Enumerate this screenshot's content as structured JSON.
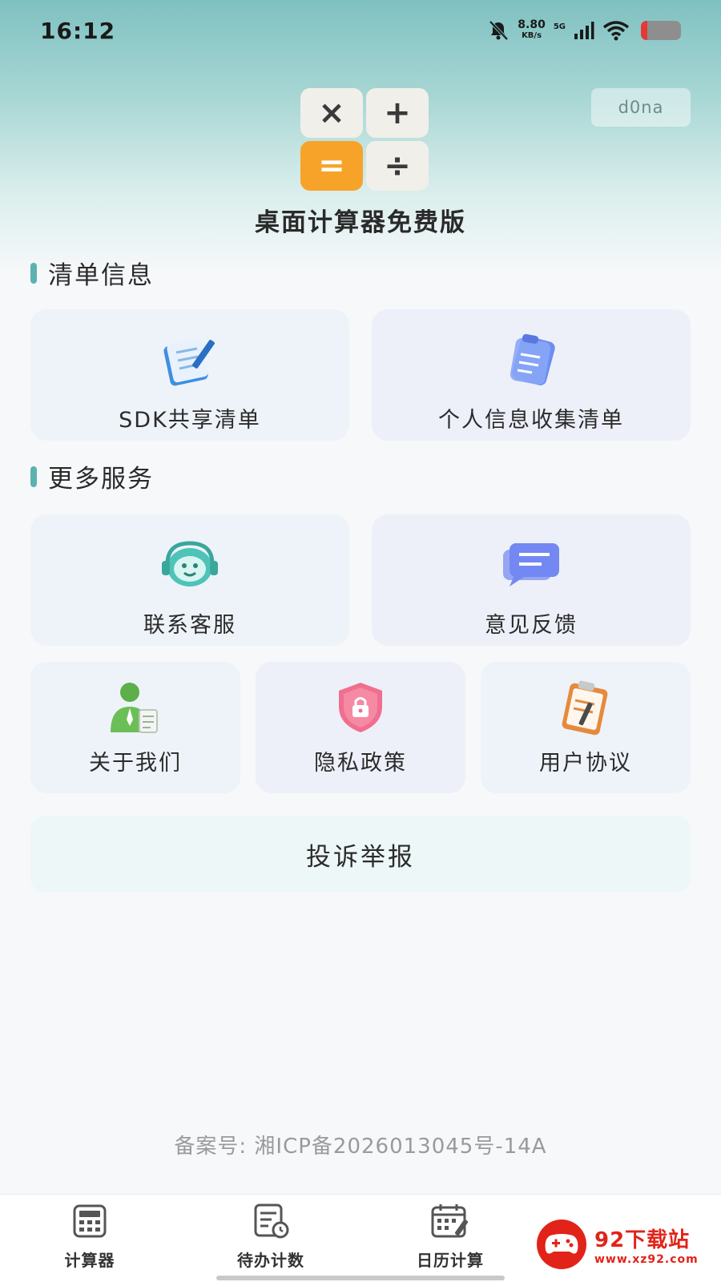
{
  "status_bar": {
    "time": "16:12",
    "net_speed": "8.80",
    "net_unit": "KB/s",
    "network": "5G",
    "battery_level": 0.15
  },
  "header": {
    "app_title": "桌面计算器免费版",
    "user_chip": "d0na",
    "logo_keys": [
      "×",
      "+",
      "=",
      "÷"
    ]
  },
  "sections": {
    "list_info": {
      "title": "清单信息",
      "items": [
        {
          "label": "SDK共享清单",
          "icon": "notepad-pen-icon"
        },
        {
          "label": "个人信息收集清单",
          "icon": "clipboard-document-icon"
        }
      ]
    },
    "more_services": {
      "title": "更多服务",
      "items": [
        {
          "label": "联系客服",
          "icon": "headset-robot-icon"
        },
        {
          "label": "意见反馈",
          "icon": "chat-bubble-icon"
        },
        {
          "label": "关于我们",
          "icon": "person-document-icon"
        },
        {
          "label": "隐私政策",
          "icon": "shield-lock-icon"
        },
        {
          "label": "用户协议",
          "icon": "clipboard-pen-icon"
        }
      ]
    }
  },
  "complaint_button": "投诉举报",
  "icp": "备案号: 湘ICP备2026013045号-14A",
  "tabbar": {
    "items": [
      {
        "label": "计算器",
        "icon": "calculator-icon"
      },
      {
        "label": "待办计数",
        "icon": "todo-clock-icon"
      },
      {
        "label": "日历计算",
        "icon": "calendar-pen-icon"
      }
    ]
  },
  "watermark": {
    "brand": "92下载站",
    "url": "www.xz92.com"
  },
  "colors": {
    "accent": "#5bb3b0",
    "logo_orange": "#f7a32a",
    "watermark_red": "#e2231a"
  }
}
